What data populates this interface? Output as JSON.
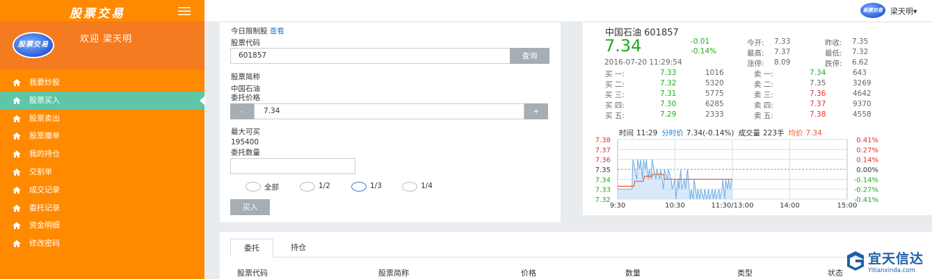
{
  "sidebar": {
    "brand": "股票交易",
    "avatar_text": "股票交易",
    "welcome": "欢迎 梁天明",
    "items": [
      {
        "label": "我要炒股"
      },
      {
        "label": "股票买入"
      },
      {
        "label": "股票卖出"
      },
      {
        "label": "股票撤单"
      },
      {
        "label": "我的持仓"
      },
      {
        "label": "交割单"
      },
      {
        "label": "成交记录"
      },
      {
        "label": "委托记录"
      },
      {
        "label": "资金明细"
      },
      {
        "label": "修改密码"
      }
    ],
    "active_index": 1
  },
  "topbar": {
    "avatar_text": "股票交易",
    "user": "梁天明"
  },
  "form": {
    "limit_label": "今日限制股",
    "limit_link": "查看",
    "code_label": "股票代码",
    "code_value": "601857",
    "query_button": "查询",
    "name_label": "股票简称",
    "name_value": "中国石油",
    "price_label": "委托价格",
    "minus": "-",
    "price_value": "7.34",
    "plus": "+",
    "max_label": "最大可买",
    "max_value": "195400",
    "qty_label": "委托数量",
    "qty_value": "",
    "radios": [
      {
        "label": "全部",
        "checked": false
      },
      {
        "label": "1/2",
        "checked": false
      },
      {
        "label": "1/3",
        "checked": true
      },
      {
        "label": "1/4",
        "checked": false
      }
    ],
    "buy_button": "买入"
  },
  "quote": {
    "name_code": "中国石油 601857",
    "price": "7.34",
    "change": "-0.01",
    "change_pct": "-0.14%",
    "datetime": "2016-07-20 11:29:54",
    "stats": [
      {
        "label": "今开:",
        "value": "7.33"
      },
      {
        "label": "昨收:",
        "value": "7.35"
      },
      {
        "label": "最高:",
        "value": "7.37"
      },
      {
        "label": "最低:",
        "value": "7.32"
      },
      {
        "label": "涨停:",
        "value": "8.09"
      },
      {
        "label": "跌停:",
        "value": "6.62"
      }
    ],
    "buy_rows": [
      {
        "label": "买 一:",
        "price": "7.33",
        "vol": "1016"
      },
      {
        "label": "买 二:",
        "price": "7.32",
        "vol": "5320"
      },
      {
        "label": "买 三:",
        "price": "7.31",
        "vol": "5775"
      },
      {
        "label": "买 四:",
        "price": "7.30",
        "vol": "6285"
      },
      {
        "label": "买 五:",
        "price": "7.29",
        "vol": "2333"
      }
    ],
    "sell_rows": [
      {
        "label": "卖 一:",
        "price": "7.34",
        "vol": "643",
        "color": "green"
      },
      {
        "label": "卖 二:",
        "price": "7.35",
        "vol": "3269",
        "color": "gray"
      },
      {
        "label": "卖 三:",
        "price": "7.36",
        "vol": "4642",
        "color": "red"
      },
      {
        "label": "卖 四:",
        "price": "7.37",
        "vol": "9370",
        "color": "red"
      },
      {
        "label": "卖 五:",
        "price": "7.38",
        "vol": "4558",
        "color": "red"
      }
    ]
  },
  "chart_data": {
    "type": "line",
    "header_time_label": "时间",
    "header_time": "11:29",
    "header_series_label": "分时价",
    "header_price": "7.34(-0.14%)",
    "header_volume_label": "成交量",
    "header_volume": "223手",
    "header_avg_label": "均价",
    "header_avg": "7.34",
    "y_left_ticks": [
      "7.38",
      "7.37",
      "7.36",
      "7.35",
      "7.34",
      "7.33",
      "7.32"
    ],
    "y_right_ticks": [
      "0.41%",
      "0.27%",
      "0.14%",
      "0.00%",
      "-0.14%",
      "-0.27%",
      "-0.41%"
    ],
    "x_ticks": [
      "9:30",
      "10:30",
      "11:30/13:00",
      "14:00",
      "15:00"
    ],
    "ylim": [
      7.32,
      7.38
    ],
    "xlim": [
      0,
      240
    ],
    "series": [
      {
        "name": "分时价",
        "color": "#6aaee8",
        "x": [
          0,
          15,
          16,
          20,
          21,
          23,
          24,
          26,
          27,
          29,
          30,
          32,
          33,
          35,
          36,
          38,
          40,
          41,
          44,
          45,
          48,
          49,
          52,
          53,
          56,
          57,
          60,
          61,
          63,
          64,
          66,
          67,
          70,
          71,
          73,
          74,
          76,
          77,
          79,
          80,
          83,
          84,
          86,
          87,
          90,
          91,
          93,
          95,
          96,
          99,
          100,
          102,
          103,
          106,
          107,
          109,
          110,
          112,
          113,
          115,
          116,
          118,
          119,
          120
        ],
        "values": [
          7.33,
          7.33,
          7.36,
          7.34,
          7.36,
          7.35,
          7.36,
          7.34,
          7.36,
          7.35,
          7.36,
          7.34,
          7.35,
          7.34,
          7.36,
          7.35,
          7.34,
          7.35,
          7.34,
          7.35,
          7.33,
          7.35,
          7.34,
          7.35,
          7.34,
          7.33,
          7.34,
          7.32,
          7.34,
          7.33,
          7.35,
          7.33,
          7.34,
          7.33,
          7.35,
          7.34,
          7.32,
          7.33,
          7.32,
          7.34,
          7.32,
          7.33,
          7.32,
          7.33,
          7.32,
          7.33,
          7.32,
          7.33,
          7.32,
          7.33,
          7.32,
          7.33,
          7.32,
          7.33,
          7.32,
          7.33,
          7.34,
          7.32,
          7.34,
          7.33,
          7.34,
          7.33,
          7.34,
          7.34
        ]
      },
      {
        "name": "均价",
        "color": "#e8582a",
        "x": [
          0,
          17,
          18,
          27,
          28,
          36,
          37,
          48,
          49,
          120
        ],
        "values": [
          7.333,
          7.333,
          7.338,
          7.338,
          7.343,
          7.343,
          7.345,
          7.345,
          7.34,
          7.34
        ]
      }
    ]
  },
  "bottom": {
    "tabs": [
      "委托",
      "持仓"
    ],
    "active_tab": 0,
    "headers": [
      "股票代码",
      "股票简称",
      "价格",
      "数量",
      "类型",
      "状态"
    ]
  },
  "watermark": {
    "text": "宜天信达",
    "sub": "Yitianxinda.com"
  },
  "colors": {
    "sidebar": "#ff8a00",
    "active_nav": "#5ec6a4",
    "price_green": "#22aa22",
    "price_red": "#e03030",
    "link_blue": "#2a7bd0"
  }
}
